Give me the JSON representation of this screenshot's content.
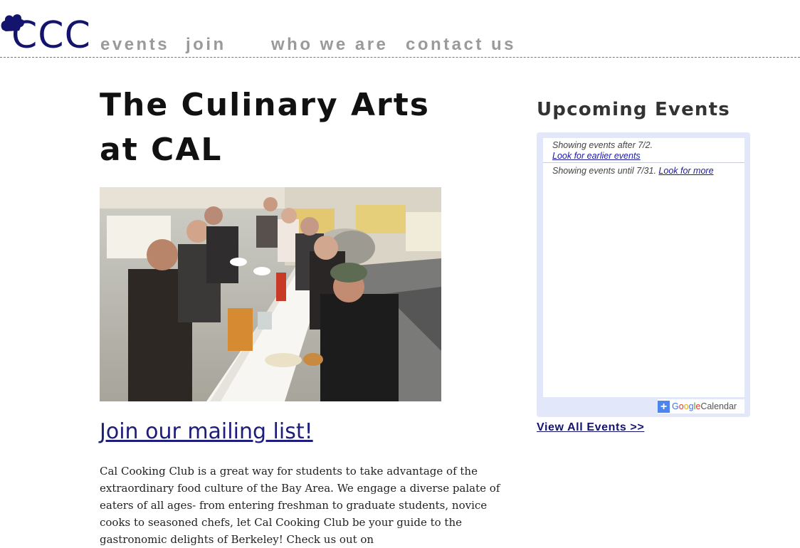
{
  "header": {
    "logo_text": "CCC",
    "nav": {
      "events": "events",
      "join": "join",
      "who_we_are": "who we are",
      "contact_us": "contact us"
    }
  },
  "main": {
    "title": "The Culinary Arts at CAL",
    "photo_alt": "Club members dining together at a long restaurant table",
    "mailing_link": "Join our mailing list!",
    "intro": "Cal Cooking Club is a great way for students to take advantage of the extraordinary food culture of the Bay Area. We engage a diverse palate of eaters of all ages- from entering freshman to graduate students, novice cooks to seasoned chefs, let Cal Cooking Club be your guide to the gastronomic delights of Berkeley! Check us out on"
  },
  "sidebar": {
    "heading": "Upcoming Events",
    "calendar": {
      "after_text": "Showing events after 7/2.",
      "earlier_link": "Look for earlier events",
      "until_text": "Showing events until 7/31.",
      "more_link": "Look for more",
      "badge_plus": "+",
      "badge_brand": [
        "G",
        "o",
        "o",
        "g",
        "l",
        "e"
      ],
      "badge_product": "Calendar"
    },
    "view_all": "View All Events >>"
  },
  "colors": {
    "brand_navy": "#14146e",
    "nav_gray": "#9a9a9a",
    "calendar_frame": "#e2e8f9",
    "link_blue": "#1a1aa6"
  }
}
